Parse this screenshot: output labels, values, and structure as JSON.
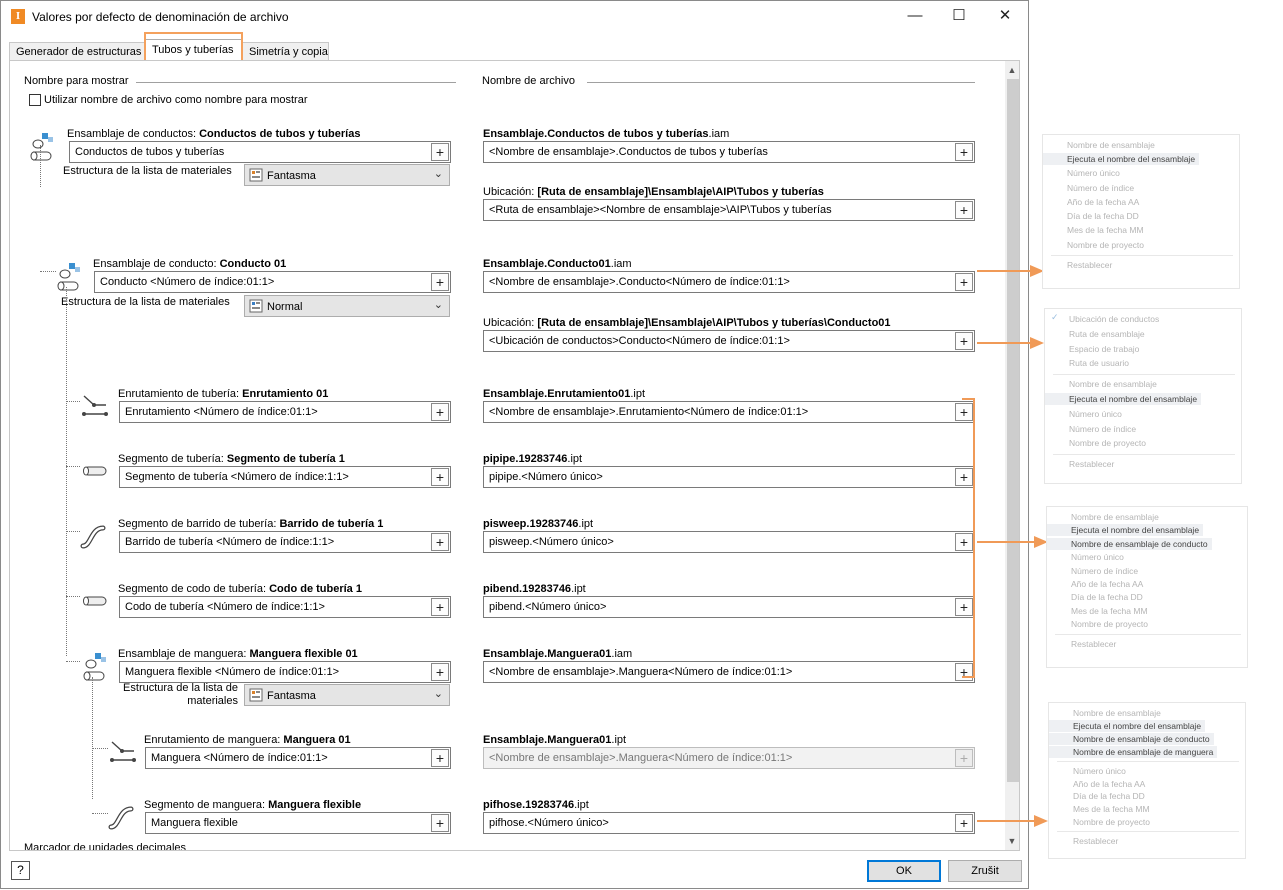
{
  "window": {
    "title": "Valores por defecto de denominación de archivo",
    "app_icon": "I",
    "minimize": "—",
    "maximize": "☐",
    "close": "✕"
  },
  "tabs": [
    "Generador de estructuras",
    "Tubos y tuberías",
    "Simetría y copia"
  ],
  "panel": {
    "display_name_header": "Nombre para mostrar",
    "file_name_header": "Nombre de archivo",
    "use_filename_checkbox": "Utilizar nombre de archivo como nombre para mostrar",
    "decimal_marker_partial": "Marcador de unidades decimales"
  },
  "plus": "+",
  "bom_label": "Estructura de la lista de materiales",
  "bom_label_line1": "Estructura de la lista de",
  "bom_label_line2": "materiales",
  "rows": [
    {
      "label_pre": "Ensamblaje de conductos: ",
      "label_bold": "Conductos de tubos y tuberías",
      "value": "Conductos de tubos y tuberías",
      "bom": "Fantasma",
      "file_bold": "Ensamblaje.Conductos de tubos y tuberías",
      "file_ext": ".iam",
      "file_value": "<Nombre de ensamblaje>.Conductos de tubos y tuberías",
      "loc_pre": "Ubicación: ",
      "loc_bold": "[Ruta de ensamblaje]\\Ensamblaje\\AIP\\Tubos y tuberías",
      "loc_value": "<Ruta de ensamblaje><Nombre de ensamblaje>\\AIP\\Tubos y tuberías"
    },
    {
      "label_pre": "Ensamblaje de conducto: ",
      "label_bold": "Conducto 01",
      "value": "Conducto <Número de índice:01:1>",
      "bom": "Normal",
      "file_bold": "Ensamblaje.Conducto01",
      "file_ext": ".iam",
      "file_value": "<Nombre de ensamblaje>.Conducto<Número de índice:01:1>",
      "loc_pre": "Ubicación: ",
      "loc_bold": "[Ruta de ensamblaje]\\Ensamblaje\\AIP\\Tubos y tuberías\\Conducto01",
      "loc_value": "<Ubicación de conductos>Conducto<Número de índice:01:1>"
    },
    {
      "label_pre": "Enrutamiento de tubería: ",
      "label_bold": "Enrutamiento 01",
      "value": "Enrutamiento <Número de índice:01:1>",
      "file_bold": "Ensamblaje.Enrutamiento01",
      "file_ext": ".ipt",
      "file_value": "<Nombre de ensamblaje>.Enrutamiento<Número de índice:01:1>"
    },
    {
      "label_pre": "Segmento de tubería: ",
      "label_bold": "Segmento de tubería 1",
      "value": "Segmento de tubería <Número de índice:1:1>",
      "file_bold": "pipipe.19283746",
      "file_ext": ".ipt",
      "file_value": "pipipe.<Número único>"
    },
    {
      "label_pre": "Segmento de barrido de tubería: ",
      "label_bold": "Barrido de tubería 1",
      "value": "Barrido de tubería <Número de índice:1:1>",
      "file_bold": "pisweep.19283746",
      "file_ext": ".ipt",
      "file_value": "pisweep.<Número único>"
    },
    {
      "label_pre": "Segmento de codo de tubería: ",
      "label_bold": "Codo de tubería 1",
      "value": "Codo de tubería <Número de índice:1:1>",
      "file_bold": "pibend.19283746",
      "file_ext": ".ipt",
      "file_value": "pibend.<Número único>"
    },
    {
      "label_pre": "Ensamblaje de manguera: ",
      "label_bold": "Manguera flexible 01",
      "value": "Manguera flexible <Número de índice:01:1>",
      "bom": "Fantasma",
      "file_bold": "Ensamblaje.Manguera01",
      "file_ext": ".iam",
      "file_value": "<Nombre de ensamblaje>.Manguera<Número de índice:01:1>"
    },
    {
      "label_pre": "Enrutamiento de manguera: ",
      "label_bold": "Manguera 01",
      "value": "Manguera <Número de índice:01:1>",
      "file_bold": "Ensamblaje.Manguera01",
      "file_ext": ".ipt",
      "file_value": "<Nombre de ensamblaje>.Manguera<Número de índice:01:1>"
    },
    {
      "label_pre": "Segmento de manguera: ",
      "label_bold": "Manguera flexible",
      "value": "Manguera flexible",
      "file_bold": "pifhose.19283746",
      "file_ext": ".ipt",
      "file_value": "pifhose.<Número único>"
    }
  ],
  "footer": {
    "help": "?",
    "ok": "OK",
    "cancel": "Zrušit"
  },
  "popups": [
    {
      "items": [
        {
          "t": "Nombre de ensamblaje",
          "on": false
        },
        {
          "t": "Ejecuta el nombre del ensamblaje",
          "on": true
        },
        {
          "t": "Número único",
          "on": false
        },
        {
          "t": "Número de índice",
          "on": false
        },
        {
          "t": "Año de la fecha AA",
          "on": false
        },
        {
          "t": "Día de la fecha DD",
          "on": false
        },
        {
          "t": "Mes de la fecha MM",
          "on": false
        },
        {
          "t": "Nombre de proyecto",
          "on": false
        },
        {
          "t": "Restablecer",
          "on": false
        }
      ]
    },
    {
      "items": [
        {
          "t": "Ubicación de conductos",
          "on": false
        },
        {
          "t": "Ruta de ensamblaje",
          "on": false
        },
        {
          "t": "Espacio de trabajo",
          "on": false
        },
        {
          "t": "Ruta de usuario",
          "on": false
        },
        {
          "t": "Nombre de ensamblaje",
          "on": false
        },
        {
          "t": "Ejecuta el nombre del ensamblaje",
          "on": true
        },
        {
          "t": "Número único",
          "on": false
        },
        {
          "t": "Número de índice",
          "on": false
        },
        {
          "t": "Nombre de proyecto",
          "on": false
        },
        {
          "t": "Restablecer",
          "on": false
        }
      ]
    },
    {
      "items": [
        {
          "t": "Nombre de ensamblaje",
          "on": false
        },
        {
          "t": "Ejecuta el nombre del ensamblaje",
          "on": true
        },
        {
          "t": "Nombre de ensamblaje de conducto",
          "on": true
        },
        {
          "t": "Número único",
          "on": false
        },
        {
          "t": "Número de índice",
          "on": false
        },
        {
          "t": "Año de la fecha AA",
          "on": false
        },
        {
          "t": "Día de la fecha DD",
          "on": false
        },
        {
          "t": "Mes de la fecha MM",
          "on": false
        },
        {
          "t": "Nombre de proyecto",
          "on": false
        },
        {
          "t": "Restablecer",
          "on": false
        }
      ]
    },
    {
      "items": [
        {
          "t": "Nombre de ensamblaje",
          "on": false
        },
        {
          "t": "Ejecuta el nombre del ensamblaje",
          "on": true
        },
        {
          "t": "Nombre de ensamblaje de conducto",
          "on": true
        },
        {
          "t": "Nombre de ensamblaje de manguera",
          "on": true
        },
        {
          "t": "Número único",
          "on": false
        },
        {
          "t": "Año de la fecha AA",
          "on": false
        },
        {
          "t": "Día de la fecha DD",
          "on": false
        },
        {
          "t": "Mes de la fecha MM",
          "on": false
        },
        {
          "t": "Nombre de proyecto",
          "on": false
        },
        {
          "t": "Restablecer",
          "on": false
        }
      ]
    }
  ],
  "colors": {
    "accent": "#0078d7",
    "highlight": "#f09a57"
  }
}
